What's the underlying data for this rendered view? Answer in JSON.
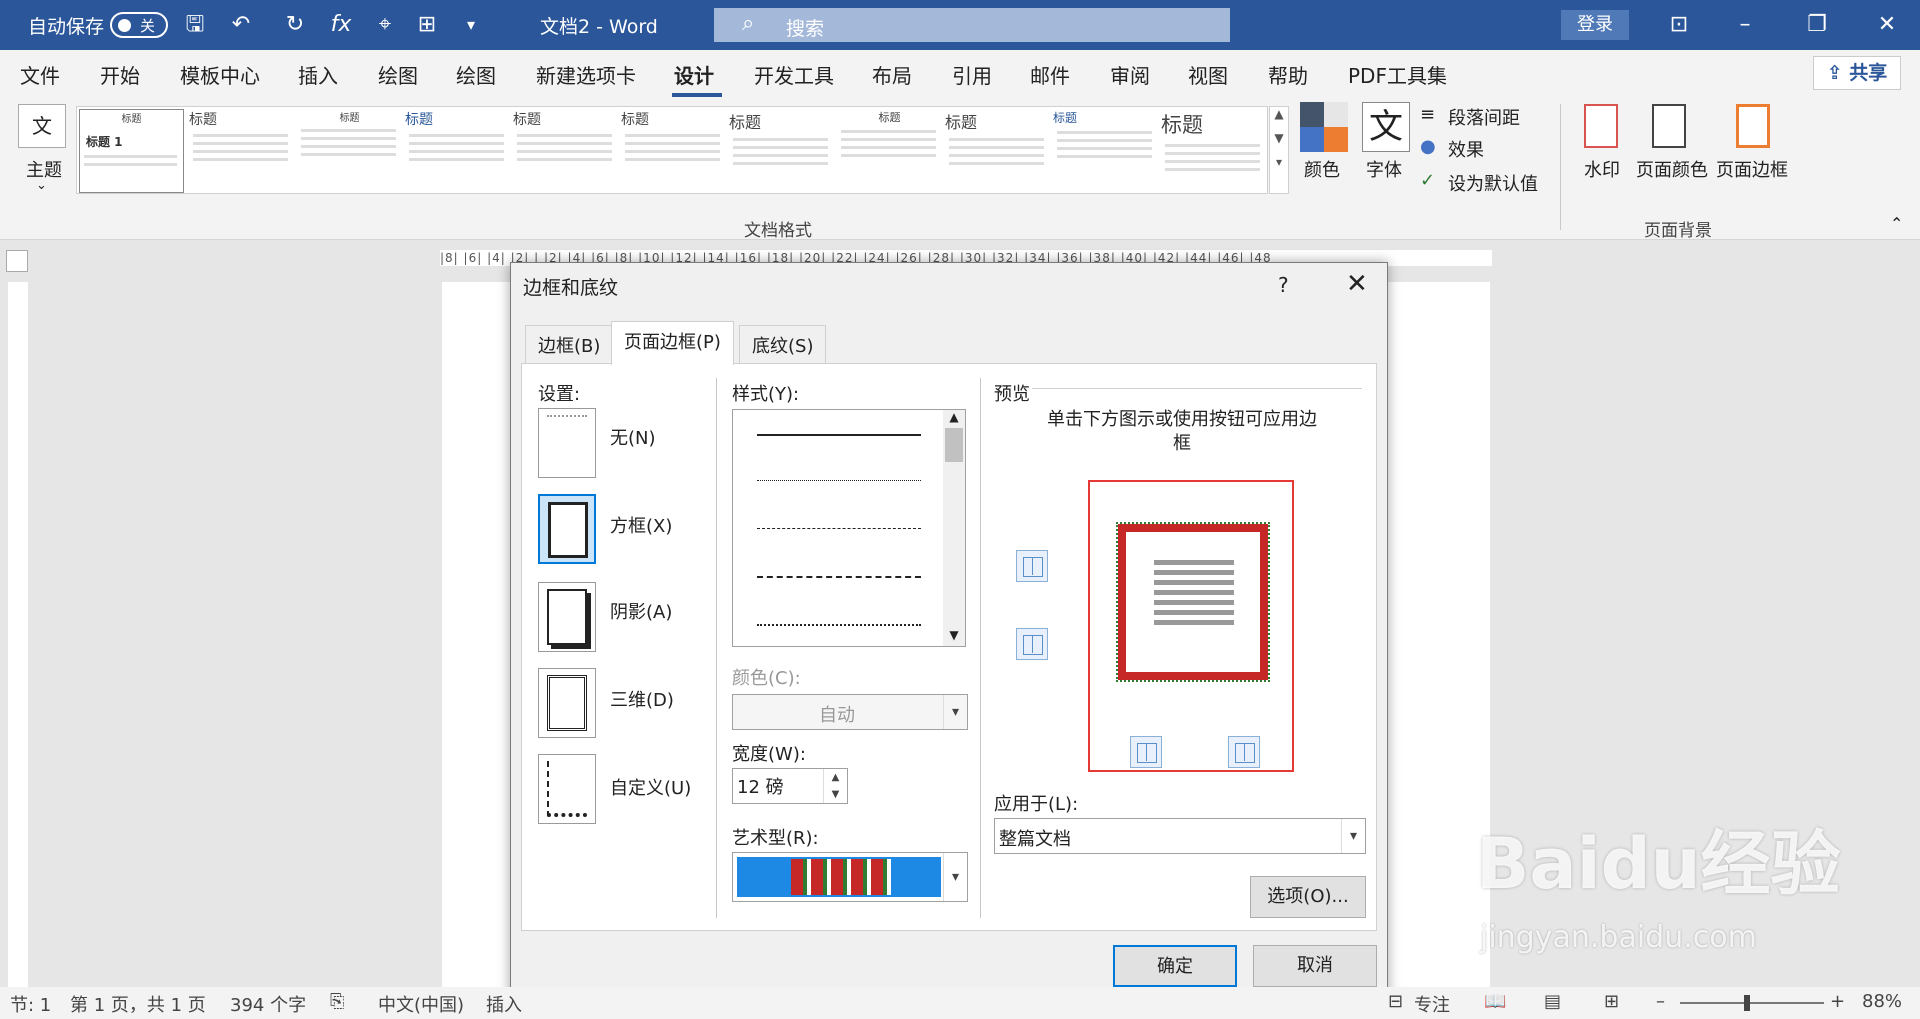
{
  "titlebar": {
    "autosave": "自动保存",
    "toggle": "关",
    "doc_title": "文档2  -  Word",
    "search": "搜索",
    "login": "登录"
  },
  "menu": {
    "items": [
      "文件",
      "开始",
      "模板中心",
      "插入",
      "绘图",
      "绘图",
      "新建选项卡",
      "设计",
      "开发工具",
      "布局",
      "引用",
      "邮件",
      "审阅",
      "视图",
      "帮助",
      "PDF工具集"
    ],
    "share": "共享"
  },
  "ribbon": {
    "theme": "主题",
    "styles": [
      "标题",
      "标题",
      "标题",
      "标题",
      "标题",
      "标题",
      "标题",
      "标题",
      "标题",
      "标题",
      "标题"
    ],
    "style_sample": "标题 1",
    "group_doc": "文档格式",
    "colors": "颜色",
    "fonts": "字体",
    "para_spacing": "段落间距",
    "effects": "效果",
    "set_default": "设为默认值",
    "watermark": "水印",
    "page_color": "页面颜色",
    "page_border": "页面边框",
    "group_bg": "页面背景"
  },
  "ruler": "|8|  |6|  |4|  |2|  |  |2|  |4|  |6|  |8|  |10|  |12|  |14|  |16|  |18|  |20|  |22|  |24|  |26|  |28|  |30|  |32|  |34|  |36|  |38|  |40|  |42|  |44|  |46|  |48",
  "dialog": {
    "title": "边框和底纹",
    "help": "?",
    "close": "✕",
    "tabs": [
      "边框(B)",
      "页面边框(P)",
      "底纹(S)"
    ],
    "settings_label": "设置:",
    "settings": [
      "无(N)",
      "方框(X)",
      "阴影(A)",
      "三维(D)",
      "自定义(U)"
    ],
    "style_label": "样式(Y):",
    "color_label": "颜色(C):",
    "color_value": "自动",
    "width_label": "宽度(W):",
    "width_value": "12 磅",
    "art_label": "艺术型(R):",
    "preview_label": "预览",
    "preview_hint": "单击下方图示或使用按钮可应用边框",
    "apply_label": "应用于(L):",
    "apply_value": "整篇文档",
    "options": "选项(O)...",
    "ok": "确定",
    "cancel": "取消"
  },
  "status": {
    "section": "节: 1",
    "page": "第 1 页，共 1 页",
    "words": "394 个字",
    "lang": "中文(中国)",
    "insert": "插入",
    "focus": "专注",
    "zoom": "88%"
  },
  "watermark": {
    "brand": "Baidu经验",
    "url": "jingyan.baidu.com"
  }
}
